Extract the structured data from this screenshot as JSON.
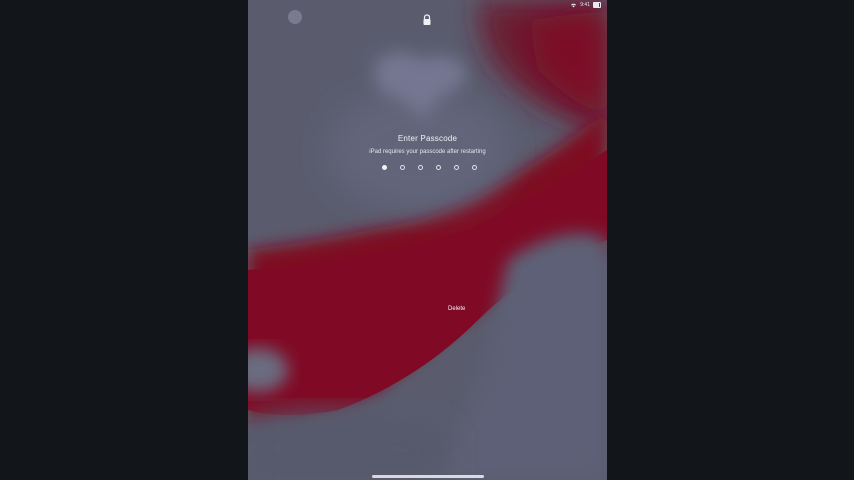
{
  "status_bar": {
    "time": "9:41",
    "wifi_icon": "wifi-icon",
    "battery_icon": "battery-icon"
  },
  "lock_icon": "lock-icon",
  "passcode": {
    "title": "Enter Passcode",
    "subtitle": "iPad requires your passcode after restarting",
    "digits_total": 6,
    "digits_entered": 1
  },
  "delete_label": "Delete",
  "colors": {
    "background": "#12161b",
    "wallpaper_gray": "#5a5c6e",
    "wallpaper_red": "#7e0a24",
    "text": "#f1f1f5"
  }
}
